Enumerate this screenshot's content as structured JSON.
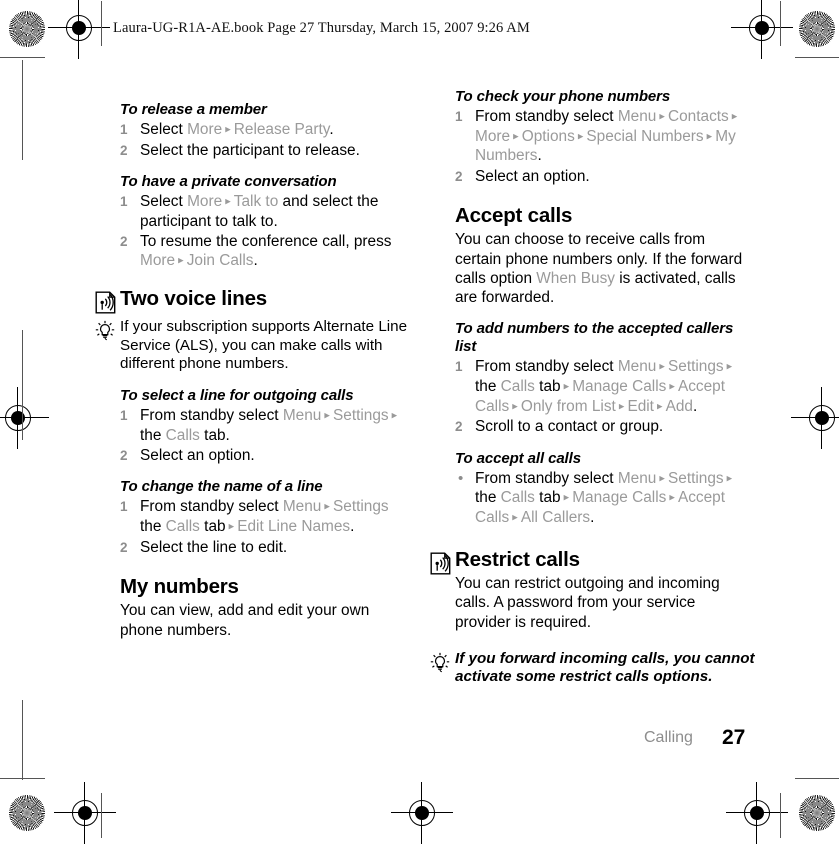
{
  "slug": "Laura-UG-R1A-AE.book  Page 27  Thursday, March 15, 2007  9:26 AM",
  "footer": {
    "chapter": "Calling",
    "page_number": "27"
  },
  "colors": {
    "body_text": "#000000",
    "menu_path_grey": "#9a9a9a",
    "step_number_grey": "#8d8d8d",
    "background": "#ffffff"
  },
  "left_column": {
    "release_member": {
      "heading": "To release a member",
      "steps": [
        {
          "num": "1",
          "parts": [
            {
              "t": "Select ",
              "s": "n"
            },
            {
              "t": "More",
              "s": "m"
            },
            {
              "t": " ▸ ",
              "s": "a"
            },
            {
              "t": "Release Party",
              "s": "m"
            },
            {
              "t": ".",
              "s": "n"
            }
          ]
        },
        {
          "num": "2",
          "parts": [
            {
              "t": "Select the participant to release.",
              "s": "n"
            }
          ]
        }
      ]
    },
    "private_conversation": {
      "heading": "To have a private conversation",
      "steps": [
        {
          "num": "1",
          "parts": [
            {
              "t": "Select ",
              "s": "n"
            },
            {
              "t": "More",
              "s": "m"
            },
            {
              "t": " ▸ ",
              "s": "a"
            },
            {
              "t": "Talk to",
              "s": "m"
            },
            {
              "t": " and select the participant to talk to.",
              "s": "n"
            }
          ]
        },
        {
          "num": "2",
          "parts": [
            {
              "t": "To resume the conference call, press ",
              "s": "n"
            },
            {
              "t": "More",
              "s": "m"
            },
            {
              "t": " ▸ ",
              "s": "a"
            },
            {
              "t": "Join Calls",
              "s": "m"
            },
            {
              "t": ".",
              "s": "n"
            }
          ]
        }
      ]
    },
    "two_voice_lines": {
      "icon": "signal-antenna-icon",
      "heading": "Two voice lines",
      "tip": {
        "icon": "lightbulb-tip-icon",
        "text": "If your subscription supports Alternate Line Service (ALS), you can make calls with different phone numbers."
      }
    },
    "select_line": {
      "heading": "To select a line for outgoing calls",
      "steps": [
        {
          "num": "1",
          "parts": [
            {
              "t": "From standby select ",
              "s": "n"
            },
            {
              "t": "Menu",
              "s": "m"
            },
            {
              "t": " ▸ ",
              "s": "a"
            },
            {
              "t": "Settings",
              "s": "m"
            },
            {
              "t": " ▸ ",
              "s": "a"
            },
            {
              "t": "the ",
              "s": "n"
            },
            {
              "t": "Calls",
              "s": "m"
            },
            {
              "t": " tab.",
              "s": "n"
            }
          ]
        },
        {
          "num": "2",
          "parts": [
            {
              "t": "Select an option.",
              "s": "n"
            }
          ]
        }
      ]
    },
    "change_line_name": {
      "heading": "To change the name of a line",
      "steps": [
        {
          "num": "1",
          "parts": [
            {
              "t": "From standby select ",
              "s": "n"
            },
            {
              "t": "Menu",
              "s": "m"
            },
            {
              "t": " ▸ ",
              "s": "a"
            },
            {
              "t": "Settings",
              "s": "m"
            },
            {
              "t": " the ",
              "s": "n"
            },
            {
              "t": "Calls",
              "s": "m"
            },
            {
              "t": " tab",
              "s": "n"
            },
            {
              "t": " ▸ ",
              "s": "a"
            },
            {
              "t": "Edit Line Names",
              "s": "m"
            },
            {
              "t": ".",
              "s": "n"
            }
          ]
        },
        {
          "num": "2",
          "parts": [
            {
              "t": "Select the line to edit.",
              "s": "n"
            }
          ]
        }
      ]
    },
    "my_numbers": {
      "heading": "My numbers",
      "body": "You can view, add and edit your own phone numbers."
    }
  },
  "right_column": {
    "check_numbers": {
      "heading": "To check your phone numbers",
      "steps": [
        {
          "num": "1",
          "parts": [
            {
              "t": "From standby select ",
              "s": "n"
            },
            {
              "t": "Menu",
              "s": "m"
            },
            {
              "t": " ▸ ",
              "s": "a"
            },
            {
              "t": "Contacts",
              "s": "m"
            },
            {
              "t": " ▸ ",
              "s": "a"
            },
            {
              "t": "More",
              "s": "m"
            },
            {
              "t": " ▸ ",
              "s": "a"
            },
            {
              "t": "Options",
              "s": "m"
            },
            {
              "t": " ▸ ",
              "s": "a"
            },
            {
              "t": "Special Numbers",
              "s": "m"
            },
            {
              "t": " ▸ ",
              "s": "a"
            },
            {
              "t": "My Numbers",
              "s": "m"
            },
            {
              "t": ".",
              "s": "n"
            }
          ]
        },
        {
          "num": "2",
          "parts": [
            {
              "t": "Select an option.",
              "s": "n"
            }
          ]
        }
      ]
    },
    "accept_calls": {
      "heading": "Accept calls",
      "body_parts": [
        {
          "t": "You can choose to receive calls from certain phone numbers only. If the forward calls option ",
          "s": "n"
        },
        {
          "t": "When Busy",
          "s": "m"
        },
        {
          "t": " is activated, calls are forwarded.",
          "s": "n"
        }
      ]
    },
    "add_accepted": {
      "heading": "To add numbers to the accepted callers list",
      "steps": [
        {
          "num": "1",
          "parts": [
            {
              "t": "From standby select ",
              "s": "n"
            },
            {
              "t": "Menu",
              "s": "m"
            },
            {
              "t": " ▸ ",
              "s": "a"
            },
            {
              "t": "Settings",
              "s": "m"
            },
            {
              "t": " ▸ ",
              "s": "a"
            },
            {
              "t": "the ",
              "s": "n"
            },
            {
              "t": "Calls",
              "s": "m"
            },
            {
              "t": " tab",
              "s": "n"
            },
            {
              "t": " ▸ ",
              "s": "a"
            },
            {
              "t": "Manage Calls",
              "s": "m"
            },
            {
              "t": " ▸ ",
              "s": "a"
            },
            {
              "t": "Accept Calls",
              "s": "m"
            },
            {
              "t": " ▸ ",
              "s": "a"
            },
            {
              "t": "Only from List",
              "s": "m"
            },
            {
              "t": " ▸ ",
              "s": "a"
            },
            {
              "t": "Edit",
              "s": "m"
            },
            {
              "t": " ▸ ",
              "s": "a"
            },
            {
              "t": "Add",
              "s": "m"
            },
            {
              "t": ".",
              "s": "n"
            }
          ]
        },
        {
          "num": "2",
          "parts": [
            {
              "t": "Scroll to a contact or group.",
              "s": "n"
            }
          ]
        }
      ]
    },
    "accept_all": {
      "heading": "To accept all calls",
      "steps": [
        {
          "num": "•",
          "bullet": true,
          "parts": [
            {
              "t": "From standby select ",
              "s": "n"
            },
            {
              "t": "Menu",
              "s": "m"
            },
            {
              "t": " ▸ ",
              "s": "a"
            },
            {
              "t": "Settings",
              "s": "m"
            },
            {
              "t": " ▸ ",
              "s": "a"
            },
            {
              "t": "the ",
              "s": "n"
            },
            {
              "t": "Calls",
              "s": "m"
            },
            {
              "t": " tab",
              "s": "n"
            },
            {
              "t": " ▸ ",
              "s": "a"
            },
            {
              "t": "Manage Calls",
              "s": "m"
            },
            {
              "t": " ▸ ",
              "s": "a"
            },
            {
              "t": "Accept Calls",
              "s": "m"
            },
            {
              "t": " ▸ ",
              "s": "a"
            },
            {
              "t": "All Callers",
              "s": "m"
            },
            {
              "t": ".",
              "s": "n"
            }
          ]
        }
      ]
    },
    "restrict_calls": {
      "icon": "signal-antenna-icon",
      "heading": "Restrict calls",
      "body": "You can restrict outgoing and incoming calls. A password from your service provider is required.",
      "tip": {
        "icon": "lightbulb-tip-icon",
        "text": "If you forward incoming calls, you cannot activate some restrict calls options."
      }
    }
  }
}
